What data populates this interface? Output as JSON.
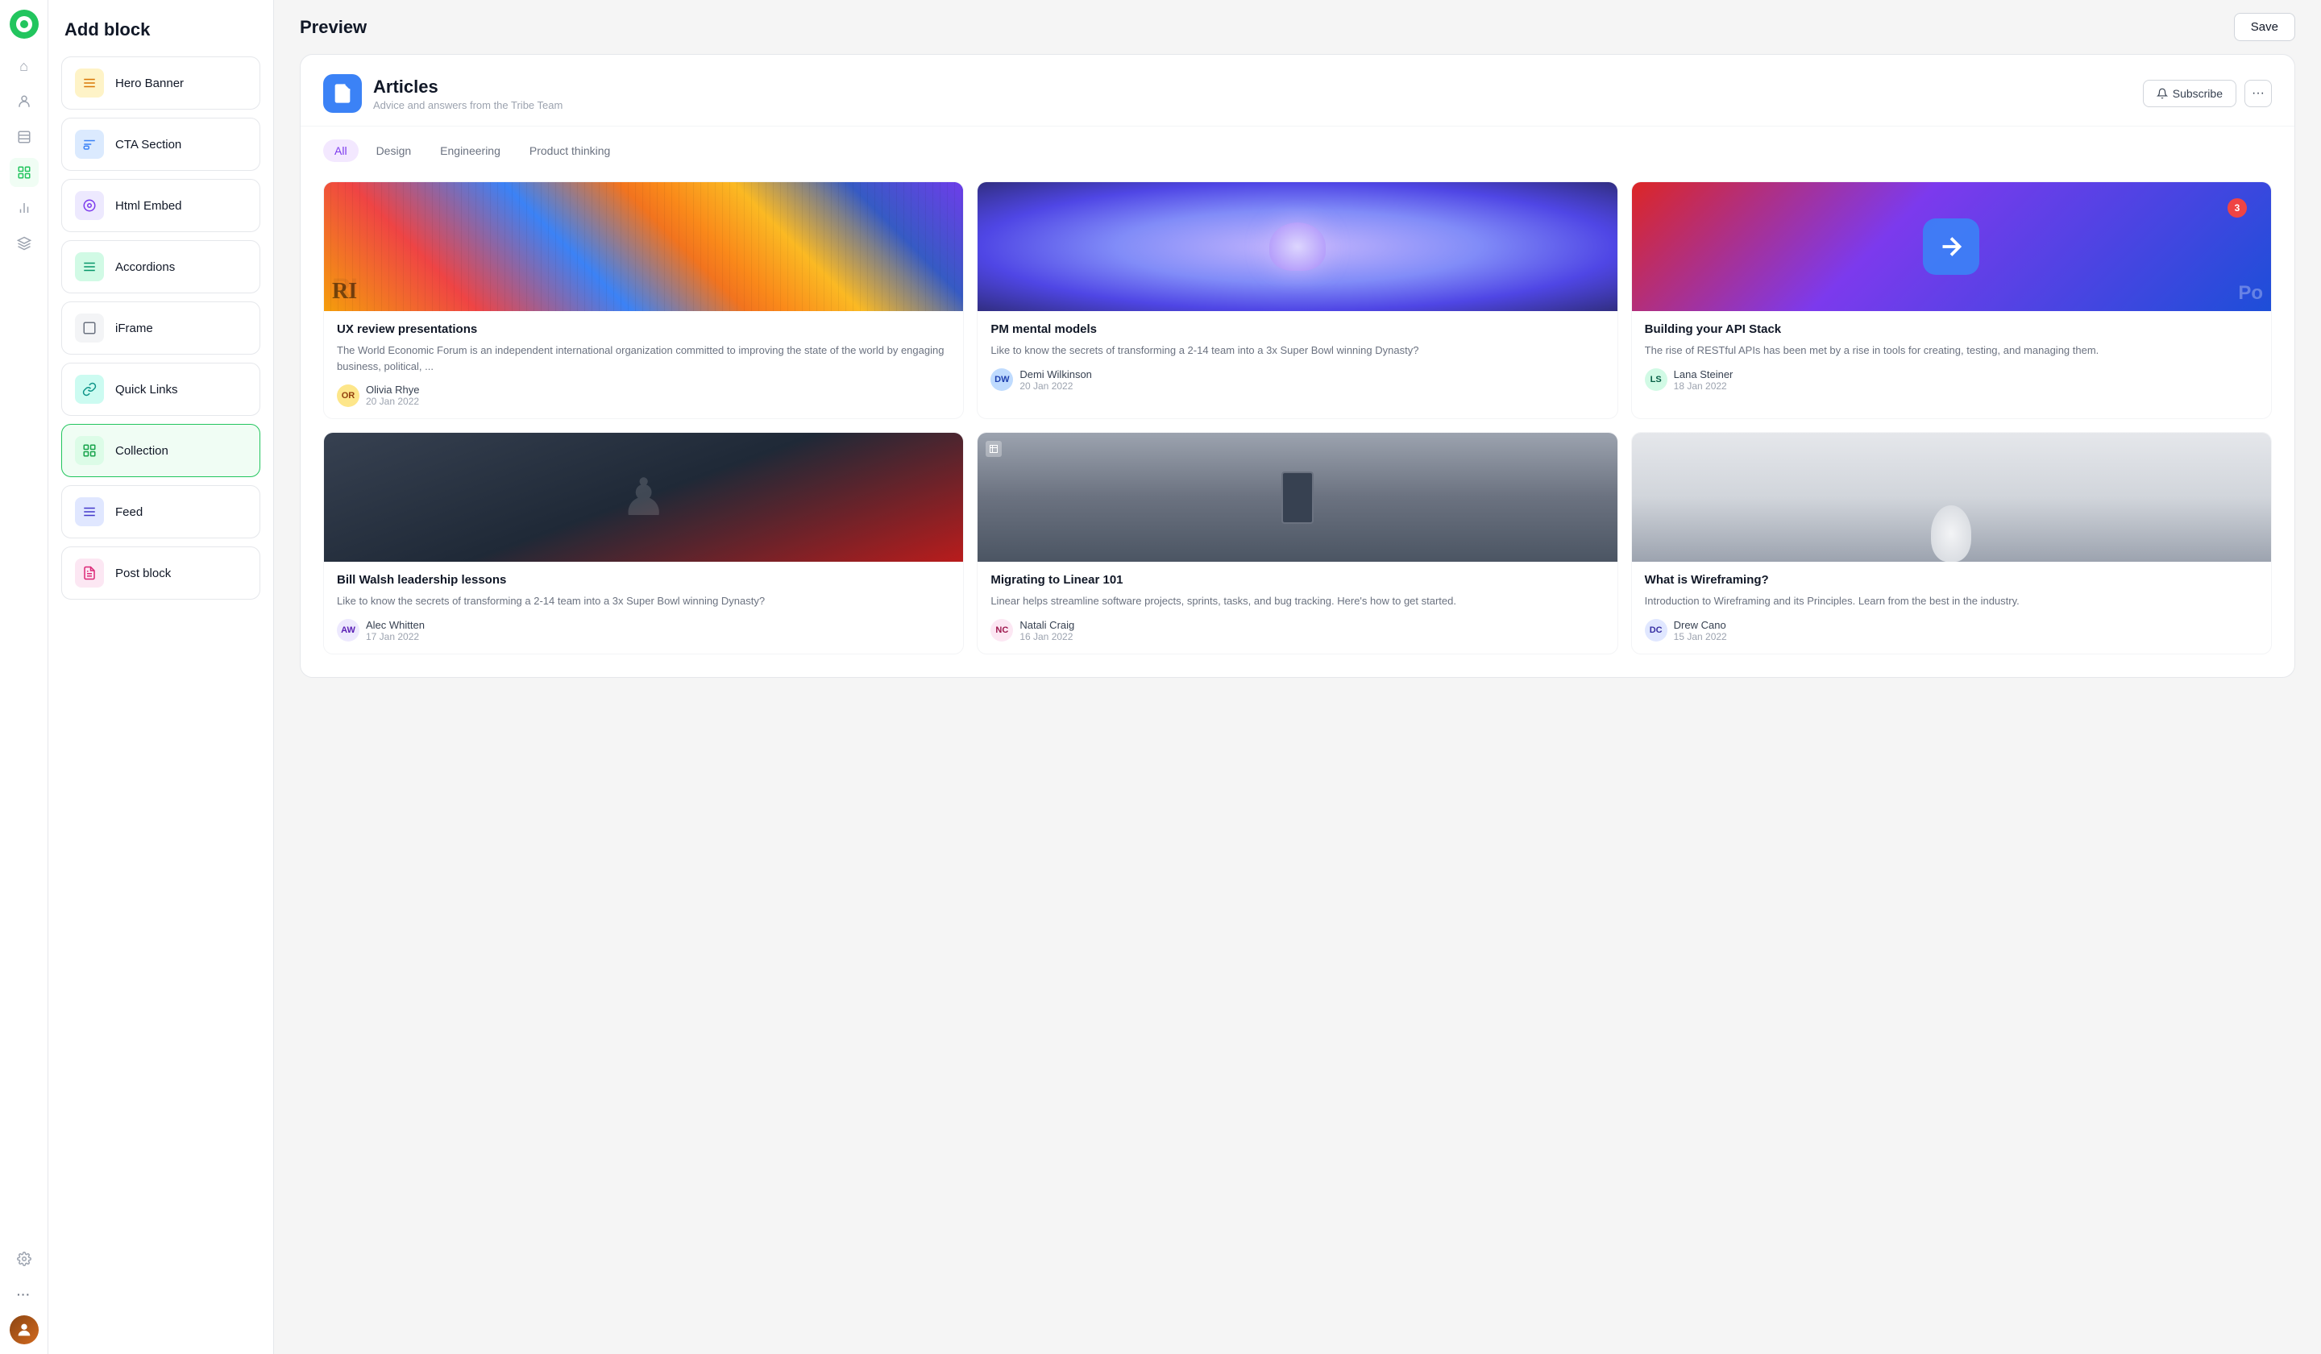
{
  "app": {
    "logo_alt": "App Logo"
  },
  "header": {
    "title": "Add block",
    "preview_title": "Preview",
    "save_label": "Save"
  },
  "sidebar_icons": [
    {
      "name": "home-icon",
      "symbol": "⌂",
      "active": false
    },
    {
      "name": "users-icon",
      "symbol": "👤",
      "active": false
    },
    {
      "name": "list-icon",
      "symbol": "☰",
      "active": false
    },
    {
      "name": "grid-icon",
      "symbol": "▦",
      "active": true
    },
    {
      "name": "chart-icon",
      "symbol": "📊",
      "active": false
    },
    {
      "name": "layers-icon",
      "symbol": "◫",
      "active": false
    },
    {
      "name": "settings-icon",
      "symbol": "⚙",
      "active": false
    },
    {
      "name": "more-icon",
      "symbol": "···",
      "active": false
    }
  ],
  "blocks": [
    {
      "id": "hero-banner",
      "label": "Hero Banner",
      "icon_type": "yellow",
      "icon": "≡",
      "active": false
    },
    {
      "id": "cta-section",
      "label": "CTA Section",
      "icon_type": "blue",
      "icon": "⚡",
      "active": false
    },
    {
      "id": "html-embed",
      "label": "Html Embed",
      "icon_type": "purple",
      "icon": "◉",
      "active": false
    },
    {
      "id": "accordions",
      "label": "Accordions",
      "icon_type": "green",
      "icon": "≡",
      "active": false
    },
    {
      "id": "iframe",
      "label": "iFrame",
      "icon_type": "gray",
      "icon": "□",
      "active": false
    },
    {
      "id": "quick-links",
      "label": "Quick Links",
      "icon_type": "teal",
      "icon": "🔗",
      "active": false
    },
    {
      "id": "collection",
      "label": "Collection",
      "icon_type": "green2",
      "icon": "⊞",
      "active": true
    },
    {
      "id": "feed",
      "label": "Feed",
      "icon_type": "indigo",
      "icon": "≡",
      "active": false
    },
    {
      "id": "post-block",
      "label": "Post block",
      "icon_type": "pink",
      "icon": "📄",
      "active": false
    }
  ],
  "preview": {
    "brand_icon": "📄",
    "brand_title": "Articles",
    "brand_subtitle": "Advice and answers from the Tribe Team",
    "subscribe_label": "Subscribe",
    "filter_tabs": [
      {
        "label": "All",
        "active": true
      },
      {
        "label": "Design",
        "active": false
      },
      {
        "label": "Engineering",
        "active": false
      },
      {
        "label": "Product thinking",
        "active": false
      }
    ],
    "articles": [
      {
        "id": "ux-review",
        "title": "UX review presentations",
        "description": "The World Economic Forum is an independent international organization committed to improving the state of the world by engaging business, political, ...",
        "author_name": "Olivia Rhye",
        "author_date": "20 Jan 2022",
        "author_initials": "OR",
        "img_type": "colorful"
      },
      {
        "id": "pm-mental",
        "title": "PM mental models",
        "description": "Like to know the secrets of transforming a 2-14 team into a 3x Super Bowl winning Dynasty?",
        "author_name": "Demi Wilkinson",
        "author_date": "20 Jan 2022",
        "author_initials": "DW",
        "img_type": "brain"
      },
      {
        "id": "api-stack",
        "title": "Building your API Stack",
        "description": "The rise of RESTful APIs has been met by a rise in tools for creating, testing, and managing them.",
        "author_name": "Lana Steiner",
        "author_date": "18 Jan 2022",
        "author_initials": "LS",
        "img_type": "appstore"
      },
      {
        "id": "bill-walsh",
        "title": "Bill Walsh leadership lessons",
        "description": "Like to know the secrets of transforming a 2-14 team into a 3x Super Bowl winning Dynasty?",
        "author_name": "Alec Whitten",
        "author_date": "17 Jan 2022",
        "author_initials": "AW",
        "img_type": "chess"
      },
      {
        "id": "linear",
        "title": "Migrating to Linear 101",
        "description": "Linear helps streamline software projects, sprints, tasks, and bug tracking. Here's how to get started.",
        "author_name": "Natali Craig",
        "author_date": "16 Jan 2022",
        "author_initials": "NC",
        "img_type": "door"
      },
      {
        "id": "wireframing",
        "title": "What is Wireframing?",
        "description": "Introduction to Wireframing and its Principles. Learn from the best in the industry.",
        "author_name": "Drew Cano",
        "author_date": "15 Jan 2022",
        "author_initials": "DC",
        "img_type": "statue"
      }
    ]
  }
}
